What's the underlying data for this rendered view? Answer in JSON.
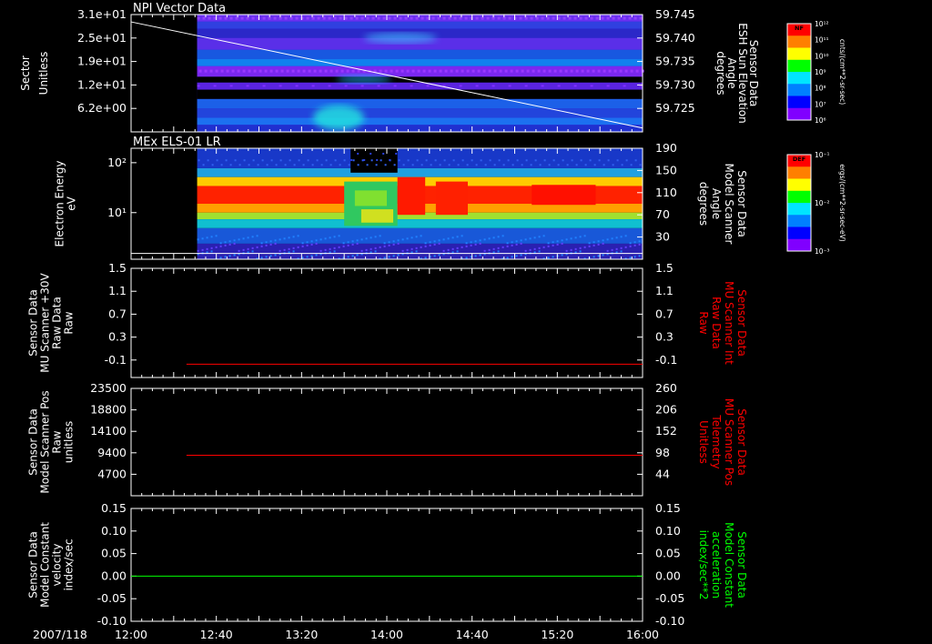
{
  "time_axis": {
    "date_label": "2007/118",
    "ticks": [
      "12:00",
      "12:40",
      "13:20",
      "14:00",
      "14:40",
      "15:20",
      "16:00"
    ]
  },
  "colorbars": [
    {
      "label": "NF",
      "unit": "cnts/(cm**2-sr-sec)",
      "ticks": [
        "10^12",
        "10^11",
        "10^10",
        "10^9",
        "10^8",
        "10^7",
        "10^6"
      ],
      "colors": [
        "#ff0000",
        "#ff7f00",
        "#ffff00",
        "#00ff00",
        "#00e5ff",
        "#0080ff",
        "#0000ff",
        "#8000ff"
      ]
    },
    {
      "label": "DEF",
      "unit": "ergs/(cm**2-sr-sec-eV)",
      "ticks": [
        "10^-1",
        "10^-2",
        "10^-3"
      ],
      "colors": [
        "#ff0000",
        "#ff7f00",
        "#ffff00",
        "#00ff00",
        "#00e5ff",
        "#0080ff",
        "#0000ff",
        "#8000ff"
      ]
    }
  ],
  "chart_data": [
    {
      "type": "heatmap",
      "title": "NPI Vector Data",
      "ylabel": [
        "Sector",
        "Unitless"
      ],
      "y_ticks": [
        "3.1e+01",
        "2.5e+01",
        "1.9e+01",
        "1.2e+01",
        "6.2e+00"
      ],
      "data_start": "12:31",
      "overlay": {
        "type": "line",
        "color": "#ffffff",
        "ylabel": [
          "Sensor Data",
          "ESH Sun Elevation",
          "Angle",
          "degrees"
        ],
        "y_ticks": [
          "59.745",
          "59.740",
          "59.735",
          "59.730",
          "59.725"
        ],
        "x": [
          "12:00",
          "16:00"
        ],
        "y": [
          59.7435,
          59.7218
        ],
        "ylim": [
          59.721,
          59.745
        ]
      }
    },
    {
      "type": "heatmap",
      "title": "MEx ELS-01 LR",
      "ylabel": [
        "Electron Energy",
        "eV"
      ],
      "y_ticks": [
        "10^2",
        "10^1"
      ],
      "yscale": "log",
      "data_start": "12:31",
      "overlay": {
        "type": "line",
        "color": "#ffffff",
        "ylabel": [
          "Sensor Data",
          "Model Scanner",
          "Angle",
          "degrees"
        ],
        "y_ticks": [
          "190",
          "150",
          "110",
          "70",
          "30"
        ],
        "x": [
          "12:00",
          "16:00"
        ],
        "y": [
          10,
          10
        ],
        "ylim": [
          0,
          190
        ]
      }
    },
    {
      "type": "line",
      "ylabel": [
        "Sensor Data",
        "MU Scanner +30V",
        "Raw Data",
        "Raw"
      ],
      "y_ticks": [
        "1.5",
        "1.1",
        "0.7",
        "0.3",
        "-0.1"
      ],
      "right_ticks": [
        "1.5",
        "1.1",
        "0.7",
        "0.3",
        "-0.1"
      ],
      "right_ylabel": [
        "Sensor Data",
        "MU Scanner Int",
        "Raw Data",
        "Raw"
      ],
      "right_color": "#ff0000",
      "series": [
        {
          "color": "#ff0000",
          "x": [
            "12:26",
            "16:00"
          ],
          "y": [
            -0.08,
            -0.08
          ]
        }
      ],
      "ylim": [
        -0.3,
        1.5
      ]
    },
    {
      "type": "line",
      "ylabel": [
        "Sensor Data",
        "Model Scanner Pos",
        "Raw",
        "unitless"
      ],
      "y_ticks": [
        "23500",
        "18800",
        "14100",
        "9400",
        "4700"
      ],
      "right_ticks": [
        "260",
        "206",
        "152",
        "98",
        "44"
      ],
      "right_ylabel": [
        "Sensor Data",
        "MU Scanner Pos",
        "Telemetry",
        "Unitless"
      ],
      "right_color": "#ff0000",
      "series": [
        {
          "color": "#ff0000",
          "x": [
            "12:26",
            "16:00"
          ],
          "y": [
            98,
            98
          ]
        }
      ],
      "ylim": [
        0,
        260
      ]
    },
    {
      "type": "line",
      "ylabel": [
        "Sensor Data",
        "Model Constant",
        "velocity",
        "index/sec"
      ],
      "y_ticks": [
        "0.15",
        "0.10",
        "0.05",
        "0.00",
        "-0.05",
        "-0.10"
      ],
      "right_ticks": [
        "0.15",
        "0.10",
        "0.05",
        "0.00",
        "-0.05",
        "-0.10"
      ],
      "right_ylabel": [
        "Sensor Data",
        "Model Constant",
        "acceleration",
        "index/sec**2"
      ],
      "right_color": "#00ff00",
      "series": [
        {
          "color": "#00ff00",
          "x": [
            "12:00",
            "16:00"
          ],
          "y": [
            0.0,
            0.0
          ]
        }
      ],
      "ylim": [
        -0.1,
        0.15
      ]
    }
  ]
}
